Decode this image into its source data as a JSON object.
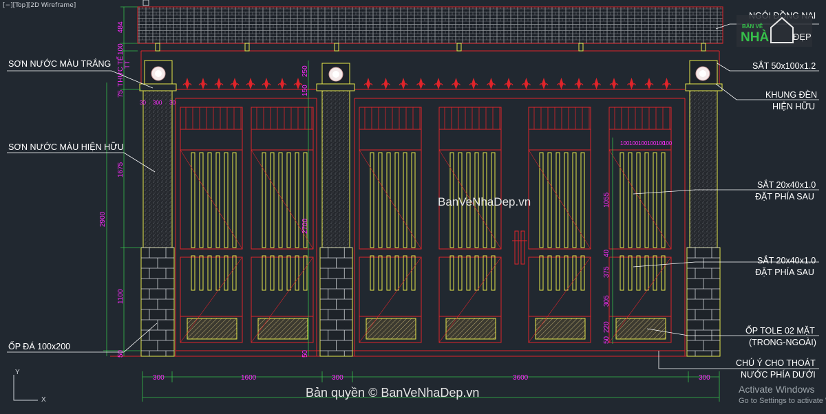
{
  "viewport": {
    "label": "[−][Top][2D Wireframe]"
  },
  "dimensions": {
    "bottom": [
      "300",
      "1600",
      "300",
      "3600",
      "300"
    ],
    "left_total": "2900",
    "left_parts": [
      "484",
      "100",
      "TT",
      "THỰC TẾ",
      "75",
      "1675",
      "1100",
      "50"
    ],
    "pillar_width": [
      "30",
      "300",
      "30"
    ],
    "center_pillar": [
      "250",
      "150",
      "2700",
      "50"
    ],
    "right_panel": [
      "100",
      "100",
      "100",
      "100",
      "100",
      "100",
      "1055",
      "40",
      "375",
      "305",
      "220",
      "50"
    ]
  },
  "callouts": {
    "left": [
      "SƠN NƯỚC MÀU TRẮNG",
      "SƠN NƯỚC MÀU HIỆN HỮU",
      "ỐP ĐÁ 100x200"
    ],
    "right": [
      "NGÓI ĐỒNG NAI",
      "SẮT 50x100x1.2",
      "KHUNG ĐÈN",
      "HIỆN HỮU",
      "SẮT 20x40x1.0",
      "ĐẶT PHÍA SAU",
      "SẮT 20x40x1.0",
      "ĐẶT PHÍA SAU",
      "ỐP TOLE 02 MẶT",
      "(TRONG-NGOÀI)",
      "CHÚ Ý CHO THOÁT",
      "NƯỚC PHÍA DƯỚI"
    ]
  },
  "watermark": {
    "center": "BanVeNhaDep.vn",
    "bottom": "Bản quyền © BanVeNhaDep.vn",
    "logo_top": "BẢN VẼ",
    "logo_nha": "NHÀ",
    "logo_dep": "ĐẸP"
  },
  "activation": {
    "title": "Activate Windows",
    "subtitle": "Go to Settings to activate W"
  },
  "ucs": {
    "x": "X",
    "y": "Y"
  },
  "colors": {
    "background": "#212830",
    "red": "#e0242a",
    "yellow": "#e8e84a",
    "magenta": "#ff2bff",
    "white": "#ffffff",
    "green": "#36c04a"
  }
}
